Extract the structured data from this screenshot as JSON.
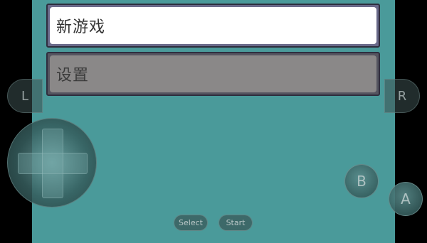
{
  "menu": {
    "items": [
      {
        "label": "新游戏",
        "selected": true
      },
      {
        "label": "设置",
        "selected": false
      }
    ]
  },
  "controls": {
    "l_label": "L",
    "r_label": "R",
    "a_label": "A",
    "b_label": "B",
    "select_label": "Select",
    "start_label": "Start",
    "dpad_icon": "dpad-icon"
  },
  "colors": {
    "background": "#000000",
    "game_screen": "#4a9a9a",
    "menu_selected_fill": "#ffffff",
    "menu_normal_fill": "#8a8888",
    "menu_frame": "#6a6a8a"
  }
}
